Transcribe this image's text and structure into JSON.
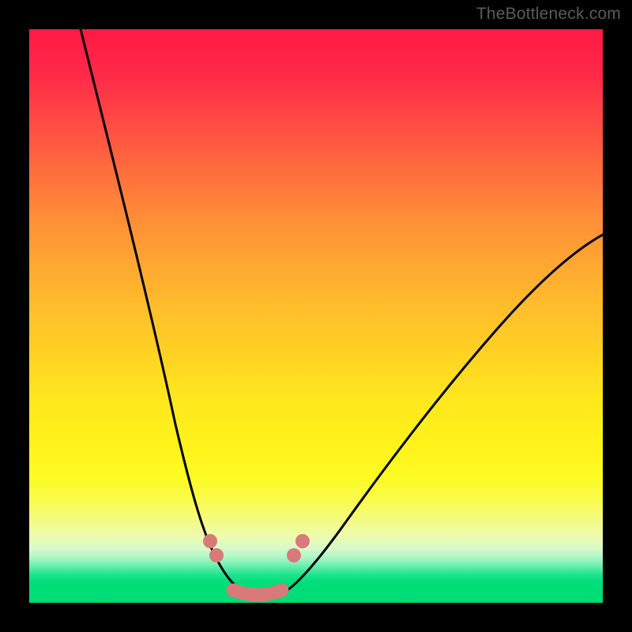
{
  "watermark": "TheBottleneck.com",
  "chart_data": {
    "type": "line",
    "title": "",
    "xlabel": "",
    "ylabel": "",
    "xlim": [
      0,
      100
    ],
    "ylim": [
      0,
      100
    ],
    "left_curve": {
      "x": [
        9,
        18,
        24,
        28,
        30,
        32,
        34,
        36,
        38,
        40
      ],
      "y": [
        100,
        55,
        30,
        16,
        12,
        9,
        6,
        4,
        2.5,
        1
      ]
    },
    "right_curve": {
      "x": [
        40,
        43,
        46,
        50,
        55,
        60,
        70,
        80,
        90,
        100
      ],
      "y": [
        1,
        2,
        4,
        8,
        13,
        19,
        31,
        43,
        54,
        64
      ]
    },
    "markers_left": [
      {
        "x": 31.5,
        "y": 10.5
      },
      {
        "x": 32.7,
        "y": 8.0
      }
    ],
    "markers_right": [
      {
        "x": 44.2,
        "y": 8.0
      },
      {
        "x": 45.8,
        "y": 10.5
      }
    ],
    "bottom_segment": {
      "xs": [
        35,
        36.5,
        38,
        39.5,
        41,
        42.5
      ],
      "y": 1.5
    },
    "gradient_stops": [
      {
        "pos": 0,
        "color": "#ff1a44"
      },
      {
        "pos": 50,
        "color": "#ffd024"
      },
      {
        "pos": 78,
        "color": "#fdfb22"
      },
      {
        "pos": 92,
        "color": "#6eefb0"
      },
      {
        "pos": 100,
        "color": "#00db74"
      }
    ]
  }
}
